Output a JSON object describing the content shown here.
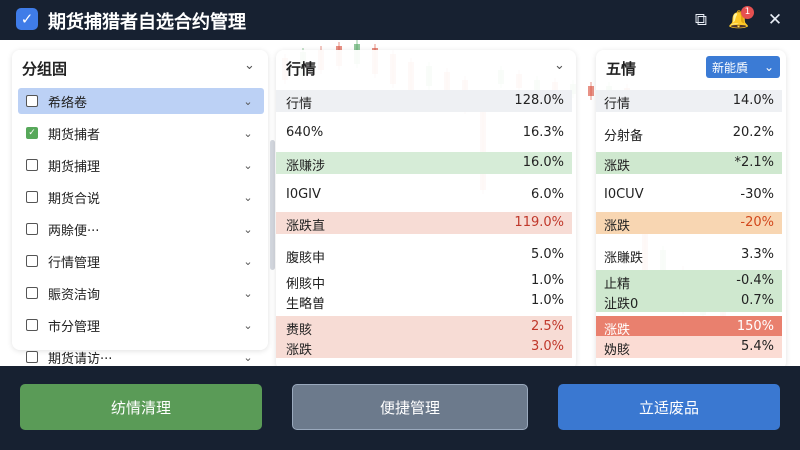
{
  "titlebar": {
    "title": "期货捕猎者自选合约管理",
    "check_icon": "checkbox-checked-icon",
    "icons": [
      "share-icon",
      "bell-icon",
      "close-icon"
    ],
    "badge": "1"
  },
  "left_panel": {
    "header": "分组固",
    "groups": [
      {
        "label": "希络卷",
        "checked": false,
        "selected": true
      },
      {
        "label": "期货捕者",
        "checked": true,
        "selected": false
      },
      {
        "label": "期货捕理",
        "checked": false,
        "selected": false
      },
      {
        "label": "期货合说",
        "checked": false,
        "selected": false
      },
      {
        "label": "两賒便···",
        "checked": false,
        "selected": false
      },
      {
        "label": "行情管理",
        "checked": false,
        "selected": false
      },
      {
        "label": "賑资洁询",
        "checked": false,
        "selected": false
      },
      {
        "label": "市分管理",
        "checked": false,
        "selected": false
      },
      {
        "label": "期货请访···",
        "checked": false,
        "selected": false
      }
    ]
  },
  "mid_panel": {
    "header": "行情",
    "rows": [
      {
        "left": "行情",
        "right": "128.0%",
        "style": "gray"
      },
      {
        "left": "640%",
        "right": "16.3%",
        "style": ""
      },
      {
        "left": "涨赚涉",
        "right": "16.0%",
        "style": "green"
      },
      {
        "left": "I0GIV",
        "right": "6.0%",
        "style": ""
      },
      {
        "left": "涨跌直",
        "right": "119.0%",
        "style": "red"
      },
      {
        "left": "腹賅申",
        "right": "5.0%",
        "style": ""
      },
      {
        "left": "俐賅中",
        "right": "1.0%",
        "style": ""
      },
      {
        "left": "生略曽",
        "right": "1.0%",
        "style": ""
      },
      {
        "left": "赉賅",
        "right": "2.5%",
        "style": "red"
      },
      {
        "left": "涨跌",
        "right": "3.0%",
        "style": "red"
      }
    ]
  },
  "right_panel": {
    "header": "五情",
    "button": "新能貭",
    "rows": [
      {
        "left": "行情",
        "right": "14.0%",
        "style": "gray"
      },
      {
        "left": "分射备",
        "right": "20.2%",
        "style": ""
      },
      {
        "left": "涨跌",
        "right": "*2.1%",
        "style": "green"
      },
      {
        "left": "I0CUV",
        "right": "-30%",
        "style": ""
      },
      {
        "left": "涨跌",
        "right": "-20%",
        "style": "orange"
      },
      {
        "left": "涨賺跌",
        "right": "3.3%",
        "style": ""
      },
      {
        "left": "止精",
        "right": "-0.4%",
        "style": "green"
      },
      {
        "left": "沚跌0",
        "right": "0.7%",
        "style": "green"
      },
      {
        "left": "涨跌",
        "right": "150%",
        "style": "red"
      },
      {
        "left": "妫賅",
        "right": "5.4%",
        "style": "pale"
      }
    ]
  },
  "footer": {
    "btn_left": "纺情清理",
    "btn_mid": "便捷管理",
    "btn_right": "立适废品"
  },
  "colors": {
    "titlebar": "#172131",
    "up": "#d84a35",
    "down": "#4aa25a",
    "accent": "#3b7bd5"
  }
}
